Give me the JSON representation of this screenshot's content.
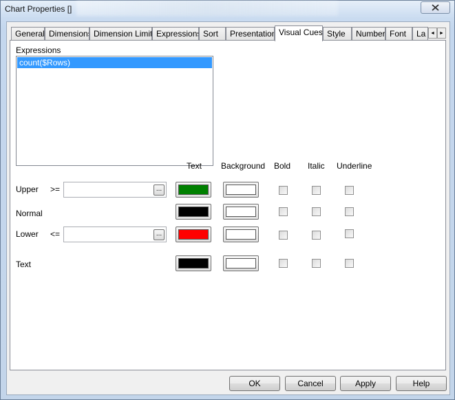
{
  "window": {
    "title": "Chart Properties []",
    "close_icon": "close-icon"
  },
  "tabs": [
    {
      "label": "General"
    },
    {
      "label": "Dimensions"
    },
    {
      "label": "Dimension Limits"
    },
    {
      "label": "Expressions"
    },
    {
      "label": "Sort"
    },
    {
      "label": "Presentation"
    },
    {
      "label": "Visual Cues",
      "active": true
    },
    {
      "label": "Style"
    },
    {
      "label": "Number"
    },
    {
      "label": "Font"
    },
    {
      "label": "La"
    }
  ],
  "tab_scroll": {
    "left": "◄",
    "right": "►"
  },
  "expressions": {
    "label": "Expressions",
    "items": [
      "count($Rows)"
    ]
  },
  "columns": {
    "text": "Text",
    "background": "Background",
    "bold": "Bold",
    "italic": "Italic",
    "underline": "Underline"
  },
  "rows": {
    "upper": {
      "label": "Upper",
      "op": ">=",
      "value": "",
      "dots": "...",
      "text_color": "#008000",
      "bg_color": "#ffffff"
    },
    "normal": {
      "label": "Normal",
      "text_color": "#000000",
      "bg_color": "#ffffff"
    },
    "lower": {
      "label": "Lower",
      "op": "<=",
      "value": "",
      "dots": "...",
      "text_color": "#ff0000",
      "bg_color": "#ffffff"
    },
    "text": {
      "label": "Text",
      "text_color": "#000000",
      "bg_color": "#ffffff"
    }
  },
  "buttons": {
    "ok": "OK",
    "cancel": "Cancel",
    "apply": "Apply",
    "help": "Help"
  }
}
